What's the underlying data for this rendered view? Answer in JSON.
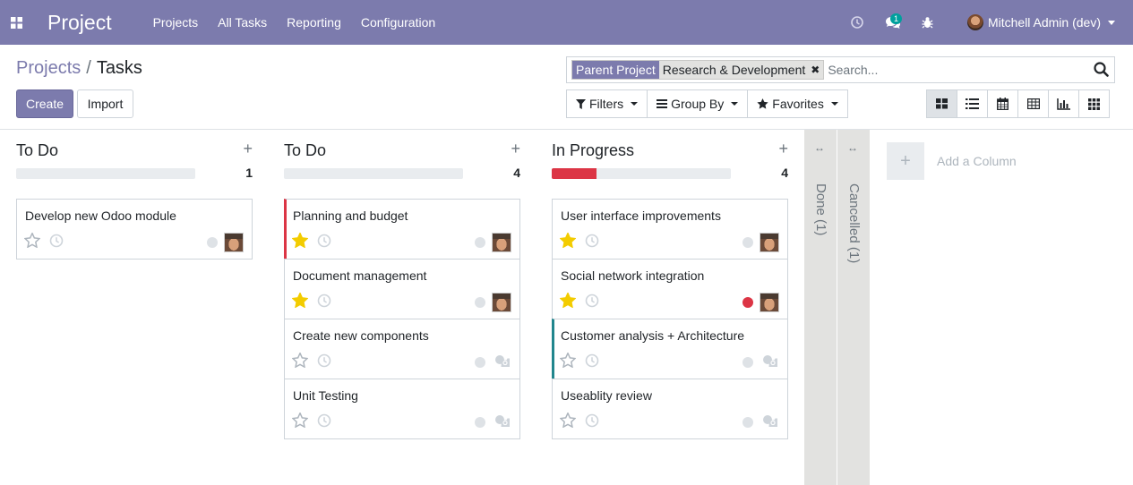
{
  "navbar": {
    "brand": "Project",
    "menu": [
      "Projects",
      "All Tasks",
      "Reporting",
      "Configuration"
    ],
    "messages_count": "1",
    "user_name": "Mitchell Admin (dev)"
  },
  "breadcrumb": {
    "parent": "Projects",
    "separator": "/",
    "current": "Tasks"
  },
  "actions": {
    "create": "Create",
    "import": "Import"
  },
  "search": {
    "facet_label": "Parent Project",
    "facet_value": "Research & Development",
    "placeholder": "Search..."
  },
  "dropdowns": {
    "filters": "Filters",
    "group_by": "Group By",
    "favorites": "Favorites"
  },
  "columns": [
    {
      "title": "To Do",
      "count": "1",
      "progress_fraction": 0,
      "cards": [
        {
          "name": "Develop new Odoo module",
          "starred": false,
          "status": "normal",
          "has_avatar": true,
          "accent": ""
        }
      ]
    },
    {
      "title": "To Do",
      "count": "4",
      "progress_fraction": 0,
      "cards": [
        {
          "name": "Planning and budget",
          "starred": true,
          "status": "normal",
          "has_avatar": true,
          "accent": "red"
        },
        {
          "name": "Document management",
          "starred": true,
          "status": "normal",
          "has_avatar": true,
          "accent": ""
        },
        {
          "name": "Create new components",
          "starred": false,
          "status": "normal",
          "has_avatar": false,
          "accent": ""
        },
        {
          "name": "Unit Testing",
          "starred": false,
          "status": "normal",
          "has_avatar": false,
          "accent": ""
        }
      ]
    },
    {
      "title": "In Progress",
      "count": "4",
      "progress_fraction": 0.25,
      "cards": [
        {
          "name": "User interface improvements",
          "starred": true,
          "status": "normal",
          "has_avatar": true,
          "accent": ""
        },
        {
          "name": "Social network integration",
          "starred": true,
          "status": "blocked",
          "has_avatar": true,
          "accent": ""
        },
        {
          "name": "Customer analysis + Architecture",
          "starred": false,
          "status": "normal",
          "has_avatar": false,
          "accent": "teal"
        },
        {
          "name": "Useablity review",
          "starred": false,
          "status": "normal",
          "has_avatar": false,
          "accent": ""
        }
      ]
    }
  ],
  "folded_columns": [
    {
      "label": "Done (1)"
    },
    {
      "label": "Cancelled (1)"
    }
  ],
  "add_column": {
    "label": "Add a Column"
  },
  "colors": {
    "brand": "#7c7bad",
    "star": "#f3cc00",
    "blocked": "#dc3545",
    "accent_teal": "#21868d"
  }
}
